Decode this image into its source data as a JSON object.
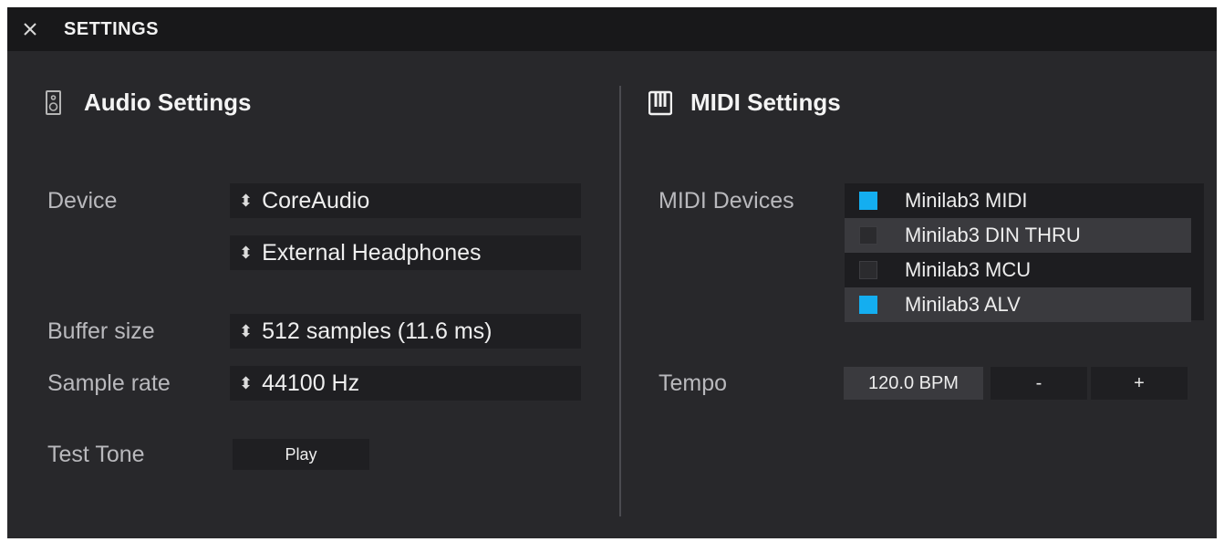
{
  "window": {
    "title": "SETTINGS"
  },
  "icons": {
    "close": "close-icon",
    "audio": "speaker-icon",
    "midi": "piano-keys-icon",
    "select_arrows": "up-down-arrows-icon"
  },
  "colors": {
    "accent": "#14aef0",
    "panel": "#28282b",
    "titlebar": "#18181a"
  },
  "audio": {
    "heading": "Audio Settings",
    "device_label": "Device",
    "device_driver": "CoreAudio",
    "device_output": "External Headphones",
    "buffer_label": "Buffer size",
    "buffer_value": "512 samples (11.6 ms)",
    "rate_label": "Sample rate",
    "rate_value": "44100 Hz",
    "tone_label": "Test Tone",
    "play_label": "Play"
  },
  "midi": {
    "heading": "MIDI Settings",
    "devices_label": "MIDI Devices",
    "devices": [
      {
        "name": "Minilab3 MIDI",
        "checked": true
      },
      {
        "name": "Minilab3 DIN THRU",
        "checked": false
      },
      {
        "name": "Minilab3 MCU",
        "checked": false
      },
      {
        "name": "Minilab3 ALV",
        "checked": true
      }
    ],
    "tempo_label": "Tempo",
    "tempo_value": "120.0 BPM",
    "tempo_minus": "-",
    "tempo_plus": "+"
  }
}
